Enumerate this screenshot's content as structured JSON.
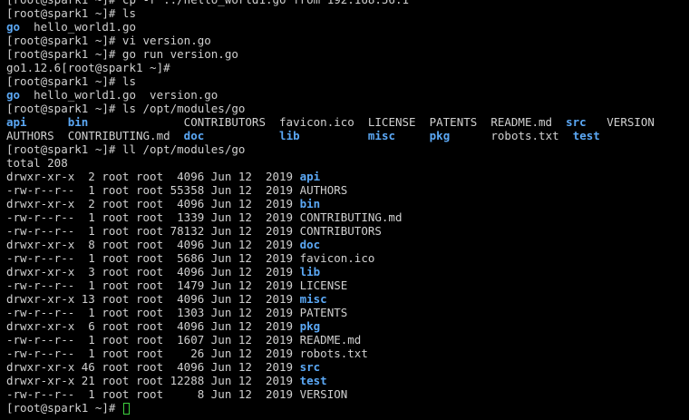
{
  "colors": {
    "background": "#000000",
    "text": "#d0d0d0",
    "directory": "#5ba8f5",
    "cursor": "#3ed13e"
  },
  "lines": [
    [
      {
        "t": "[root@spark1 ~]# cp -r ../hello_world1.go from 192.168.56.1",
        "c": "plain"
      }
    ],
    [
      {
        "t": "[root@spark1 ~]# ls",
        "c": "plain"
      }
    ],
    [
      {
        "t": "go",
        "c": "dir"
      },
      {
        "t": "  hello_world1.go",
        "c": "plain"
      }
    ],
    [
      {
        "t": "[root@spark1 ~]# vi version.go",
        "c": "plain"
      }
    ],
    [
      {
        "t": "[root@spark1 ~]# go run version.go",
        "c": "plain"
      }
    ],
    [
      {
        "t": "go1.12.6[root@spark1 ~]#",
        "c": "plain"
      }
    ],
    [
      {
        "t": "[root@spark1 ~]# ls",
        "c": "plain"
      }
    ],
    [
      {
        "t": "go",
        "c": "dir"
      },
      {
        "t": "  hello_world1.go  version.go",
        "c": "plain"
      }
    ],
    [
      {
        "t": "[root@spark1 ~]# ls /opt/modules/go",
        "c": "plain"
      }
    ],
    [
      {
        "t": "api",
        "c": "dir"
      },
      {
        "t": "      ",
        "c": "plain"
      },
      {
        "t": "bin",
        "c": "dir"
      },
      {
        "t": "              CONTRIBUTORS  favicon.ico  LICENSE  PATENTS  README.md  ",
        "c": "plain"
      },
      {
        "t": "src",
        "c": "dir"
      },
      {
        "t": "   VERSION",
        "c": "plain"
      }
    ],
    [
      {
        "t": "AUTHORS  CONTRIBUTING.md  ",
        "c": "plain"
      },
      {
        "t": "doc",
        "c": "dir"
      },
      {
        "t": "           ",
        "c": "plain"
      },
      {
        "t": "lib",
        "c": "dir"
      },
      {
        "t": "          ",
        "c": "plain"
      },
      {
        "t": "misc",
        "c": "dir"
      },
      {
        "t": "     ",
        "c": "plain"
      },
      {
        "t": "pkg",
        "c": "dir"
      },
      {
        "t": "      robots.txt  ",
        "c": "plain"
      },
      {
        "t": "test",
        "c": "dir"
      }
    ],
    [
      {
        "t": "[root@spark1 ~]# ll /opt/modules/go",
        "c": "plain"
      }
    ],
    [
      {
        "t": "total 208",
        "c": "plain"
      }
    ],
    [
      {
        "t": "drwxr-xr-x  2 root root  4096 Jun 12  2019 ",
        "c": "plain"
      },
      {
        "t": "api",
        "c": "dir"
      }
    ],
    [
      {
        "t": "-rw-r--r--  1 root root 55358 Jun 12  2019 AUTHORS",
        "c": "plain"
      }
    ],
    [
      {
        "t": "drwxr-xr-x  2 root root  4096 Jun 12  2019 ",
        "c": "plain"
      },
      {
        "t": "bin",
        "c": "dir"
      }
    ],
    [
      {
        "t": "-rw-r--r--  1 root root  1339 Jun 12  2019 CONTRIBUTING.md",
        "c": "plain"
      }
    ],
    [
      {
        "t": "-rw-r--r--  1 root root 78132 Jun 12  2019 CONTRIBUTORS",
        "c": "plain"
      }
    ],
    [
      {
        "t": "drwxr-xr-x  8 root root  4096 Jun 12  2019 ",
        "c": "plain"
      },
      {
        "t": "doc",
        "c": "dir"
      }
    ],
    [
      {
        "t": "-rw-r--r--  1 root root  5686 Jun 12  2019 favicon.ico",
        "c": "plain"
      }
    ],
    [
      {
        "t": "drwxr-xr-x  3 root root  4096 Jun 12  2019 ",
        "c": "plain"
      },
      {
        "t": "lib",
        "c": "dir"
      }
    ],
    [
      {
        "t": "-rw-r--r--  1 root root  1479 Jun 12  2019 LICENSE",
        "c": "plain"
      }
    ],
    [
      {
        "t": "drwxr-xr-x 13 root root  4096 Jun 12  2019 ",
        "c": "plain"
      },
      {
        "t": "misc",
        "c": "dir"
      }
    ],
    [
      {
        "t": "-rw-r--r--  1 root root  1303 Jun 12  2019 PATENTS",
        "c": "plain"
      }
    ],
    [
      {
        "t": "drwxr-xr-x  6 root root  4096 Jun 12  2019 ",
        "c": "plain"
      },
      {
        "t": "pkg",
        "c": "dir"
      }
    ],
    [
      {
        "t": "-rw-r--r--  1 root root  1607 Jun 12  2019 README.md",
        "c": "plain"
      }
    ],
    [
      {
        "t": "-rw-r--r--  1 root root    26 Jun 12  2019 robots.txt",
        "c": "plain"
      }
    ],
    [
      {
        "t": "drwxr-xr-x 46 root root  4096 Jun 12  2019 ",
        "c": "plain"
      },
      {
        "t": "src",
        "c": "dir"
      }
    ],
    [
      {
        "t": "drwxr-xr-x 21 root root 12288 Jun 12  2019 ",
        "c": "plain"
      },
      {
        "t": "test",
        "c": "dir"
      }
    ],
    [
      {
        "t": "-rw-r--r--  1 root root     8 Jun 12  2019 VERSION",
        "c": "plain"
      }
    ]
  ],
  "prompt": "[root@spark1 ~]# "
}
